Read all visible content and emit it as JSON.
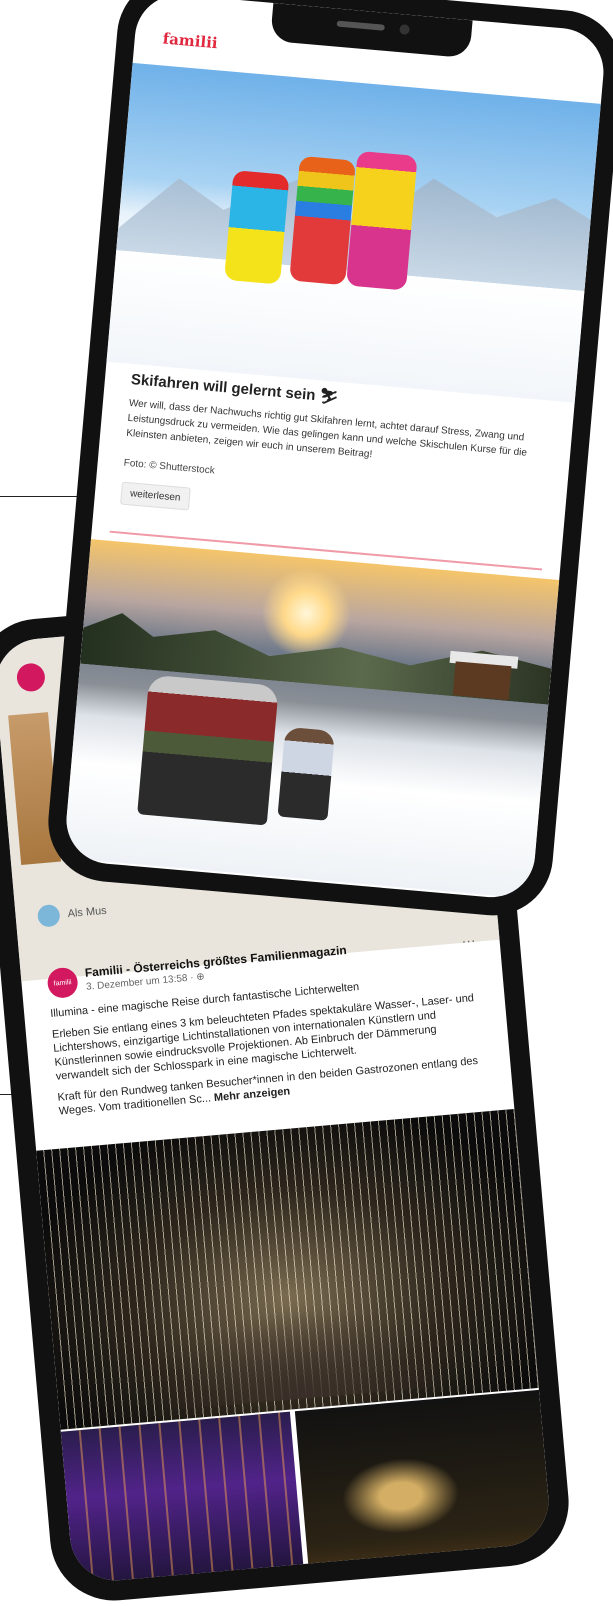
{
  "front_phone": {
    "logo": "familii",
    "article": {
      "title": "Skifahren will gelernt sein",
      "title_emoji": "⛷",
      "text": "Wer will, dass der Nachwuchs richtig gut Skifahren lernt, achtet darauf Stress, Zwang und Leistungsdruck zu vermeiden. Wie das gelingen kann und welche Skischulen Kurse für die Kleinsten anbieten, zeigen wir euch in unserem Beitrag!",
      "credit": "Foto: © Shutterstock",
      "read_more": "weiterlesen"
    },
    "accent_color": "#e0283f"
  },
  "back_phone": {
    "comment_placeholder": "Als Mus",
    "post": {
      "avatar_label": "familii",
      "page_name": "Familii - Österreichs größtes Familienmagazin",
      "meta": "3. Dezember um 13:58 · ",
      "globe_icon": "globe-icon",
      "dots": "···",
      "paragraphs": [
        "Illumina - eine magische Reise durch fantastische Lichterwelten",
        "Erleben Sie entlang eines 3 km beleuchteten Pfades spektakuläre Wasser-, Laser- und Lichtershows, einzigartige Lichtinstallationen von internationalen Künstlern und Künstlerinnen sowie eindrucksvolle Projektionen. Ab Einbruch der Dämmerung verwandelt sich der Schlosspark in eine magische Lichterwelt.",
        "Kraft für den Rundweg tanken Besucher*innen in den beiden Gastrozonen entlang des Weges. Vom traditionellen Sc..."
      ],
      "more": "Mehr anzeigen"
    },
    "brand_color": "#d2185e"
  }
}
